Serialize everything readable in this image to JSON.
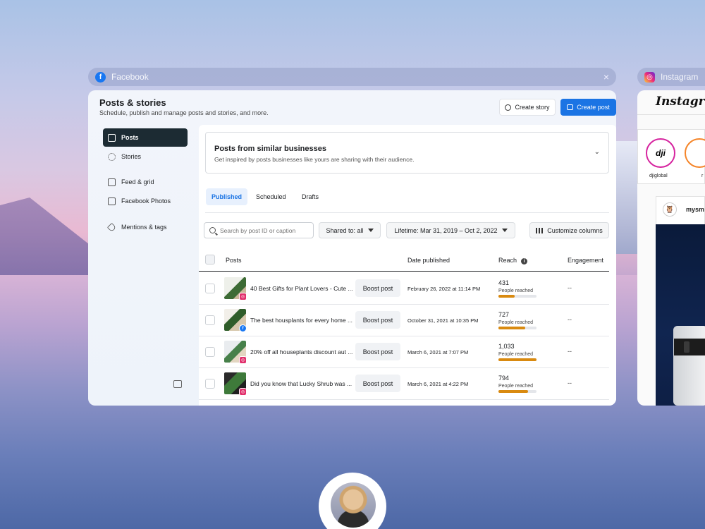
{
  "fb_window": {
    "tab_title": "Facebook",
    "close_glyph": "×",
    "page_title": "Posts & stories",
    "page_subtitle": "Schedule, publish and manage posts and stories, and more.",
    "create_story_label": "Create story",
    "create_post_label": "Create post",
    "accent_color": "#1b74e4"
  },
  "sidebar": {
    "items": [
      {
        "label": "Posts",
        "icon": "posts-icon",
        "active": true
      },
      {
        "label": "Stories",
        "icon": "stories-icon"
      },
      {
        "label": "Feed & grid",
        "icon": "feed-grid-icon"
      },
      {
        "label": "Facebook Photos",
        "icon": "photos-icon"
      },
      {
        "label": "Mentions & tags",
        "icon": "tag-icon"
      }
    ]
  },
  "similar": {
    "title": "Posts from similar businesses",
    "subtitle": "Get inspired by posts businesses like yours are sharing with their audience.",
    "chevron": "⌄"
  },
  "tabs": [
    {
      "label": "Published",
      "active": true
    },
    {
      "label": "Scheduled"
    },
    {
      "label": "Drafts"
    }
  ],
  "filters": {
    "search_placeholder": "Search by post ID or caption",
    "shared_to": "Shared to: all",
    "date_range": "Lifetime: Mar 31, 2019 – Oct 2, 2022",
    "customize_columns": "Customize columns"
  },
  "table": {
    "headers": {
      "posts": "Posts",
      "date": "Date published",
      "reach": "Reach",
      "engagement": "Engagement",
      "info": "i"
    },
    "boost_label": "Boost post",
    "reach_label": "People reached",
    "rows": [
      {
        "caption": "40 Best Gifts for Plant Lovers - Cute ...",
        "network": "instagram",
        "date": "February 26, 2022 at 11:14 PM",
        "reach": "431",
        "reach_fraction": 0.42,
        "engagement": "--"
      },
      {
        "caption": "The best housplants for every home ...",
        "network": "facebook",
        "date": "October 31, 2021 at 10:35 PM",
        "reach": "727",
        "reach_fraction": 0.7,
        "engagement": "--"
      },
      {
        "caption": "20% off all houseplants discount aut ...",
        "network": "instagram",
        "date": "March 6, 2021 at 7:07 PM",
        "reach": "1,033",
        "reach_fraction": 1.0,
        "engagement": "--"
      },
      {
        "caption": "Did you know that Lucky Shrub was ...",
        "network": "instagram",
        "date": "March 6, 2021 at 4:22 PM",
        "reach": "794",
        "reach_fraction": 0.77,
        "engagement": "--"
      }
    ]
  },
  "ig_window": {
    "tab_title": "Instagram",
    "logo_text": "Instagram",
    "stories": [
      {
        "name": "djiglobal",
        "initials": "dji"
      },
      {
        "name": "r",
        "initials": ""
      }
    ],
    "post_user": "mysm"
  }
}
